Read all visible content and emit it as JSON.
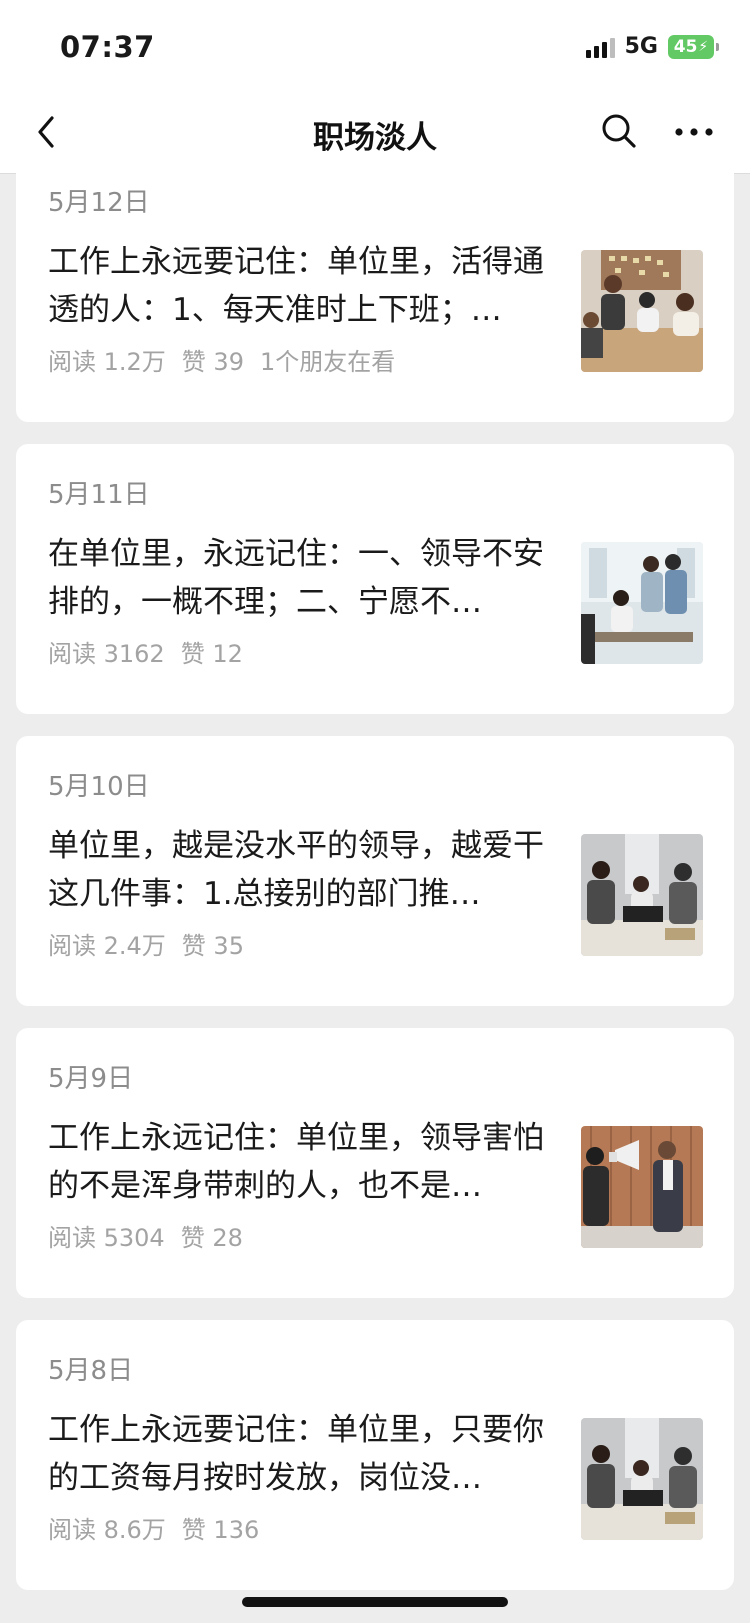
{
  "status": {
    "time": "07:37",
    "network": "5G",
    "battery": "45"
  },
  "nav": {
    "title": "职场淡人"
  },
  "articles": [
    {
      "date": "5月12日",
      "title": "工作上永远要记住：单位里，活得通透的人：1、每天准时上下班；…",
      "reads": "阅读 1.2万",
      "likes": "赞 39",
      "friends": "1个朋友在看",
      "thumb_icon": "office-meeting-photo"
    },
    {
      "date": "5月11日",
      "title": "在单位里，永远记住：一、领导不安排的，一概不理；二、宁愿不…",
      "reads": "阅读 3162",
      "likes": "赞 12",
      "thumb_icon": "team-discussion-photo"
    },
    {
      "date": "5月10日",
      "title": "单位里，越是没水平的领导，越爱干这几件事：1.总接别的部门推…",
      "reads": "阅读 2.4万",
      "likes": "赞 35",
      "thumb_icon": "office-conflict-photo"
    },
    {
      "date": "5月9日",
      "title": "工作上永远记住：单位里，领导害怕的不是浑身带刺的人，也不是…",
      "reads": "阅读 5304",
      "likes": "赞 28",
      "thumb_icon": "megaphone-boss-photo"
    },
    {
      "date": "5月8日",
      "title": "工作上永远要记住：单位里，只要你的工资每月按时发放，岗位没…",
      "reads": "阅读 8.6万",
      "likes": "赞 136",
      "thumb_icon": "office-conflict-photo"
    }
  ]
}
